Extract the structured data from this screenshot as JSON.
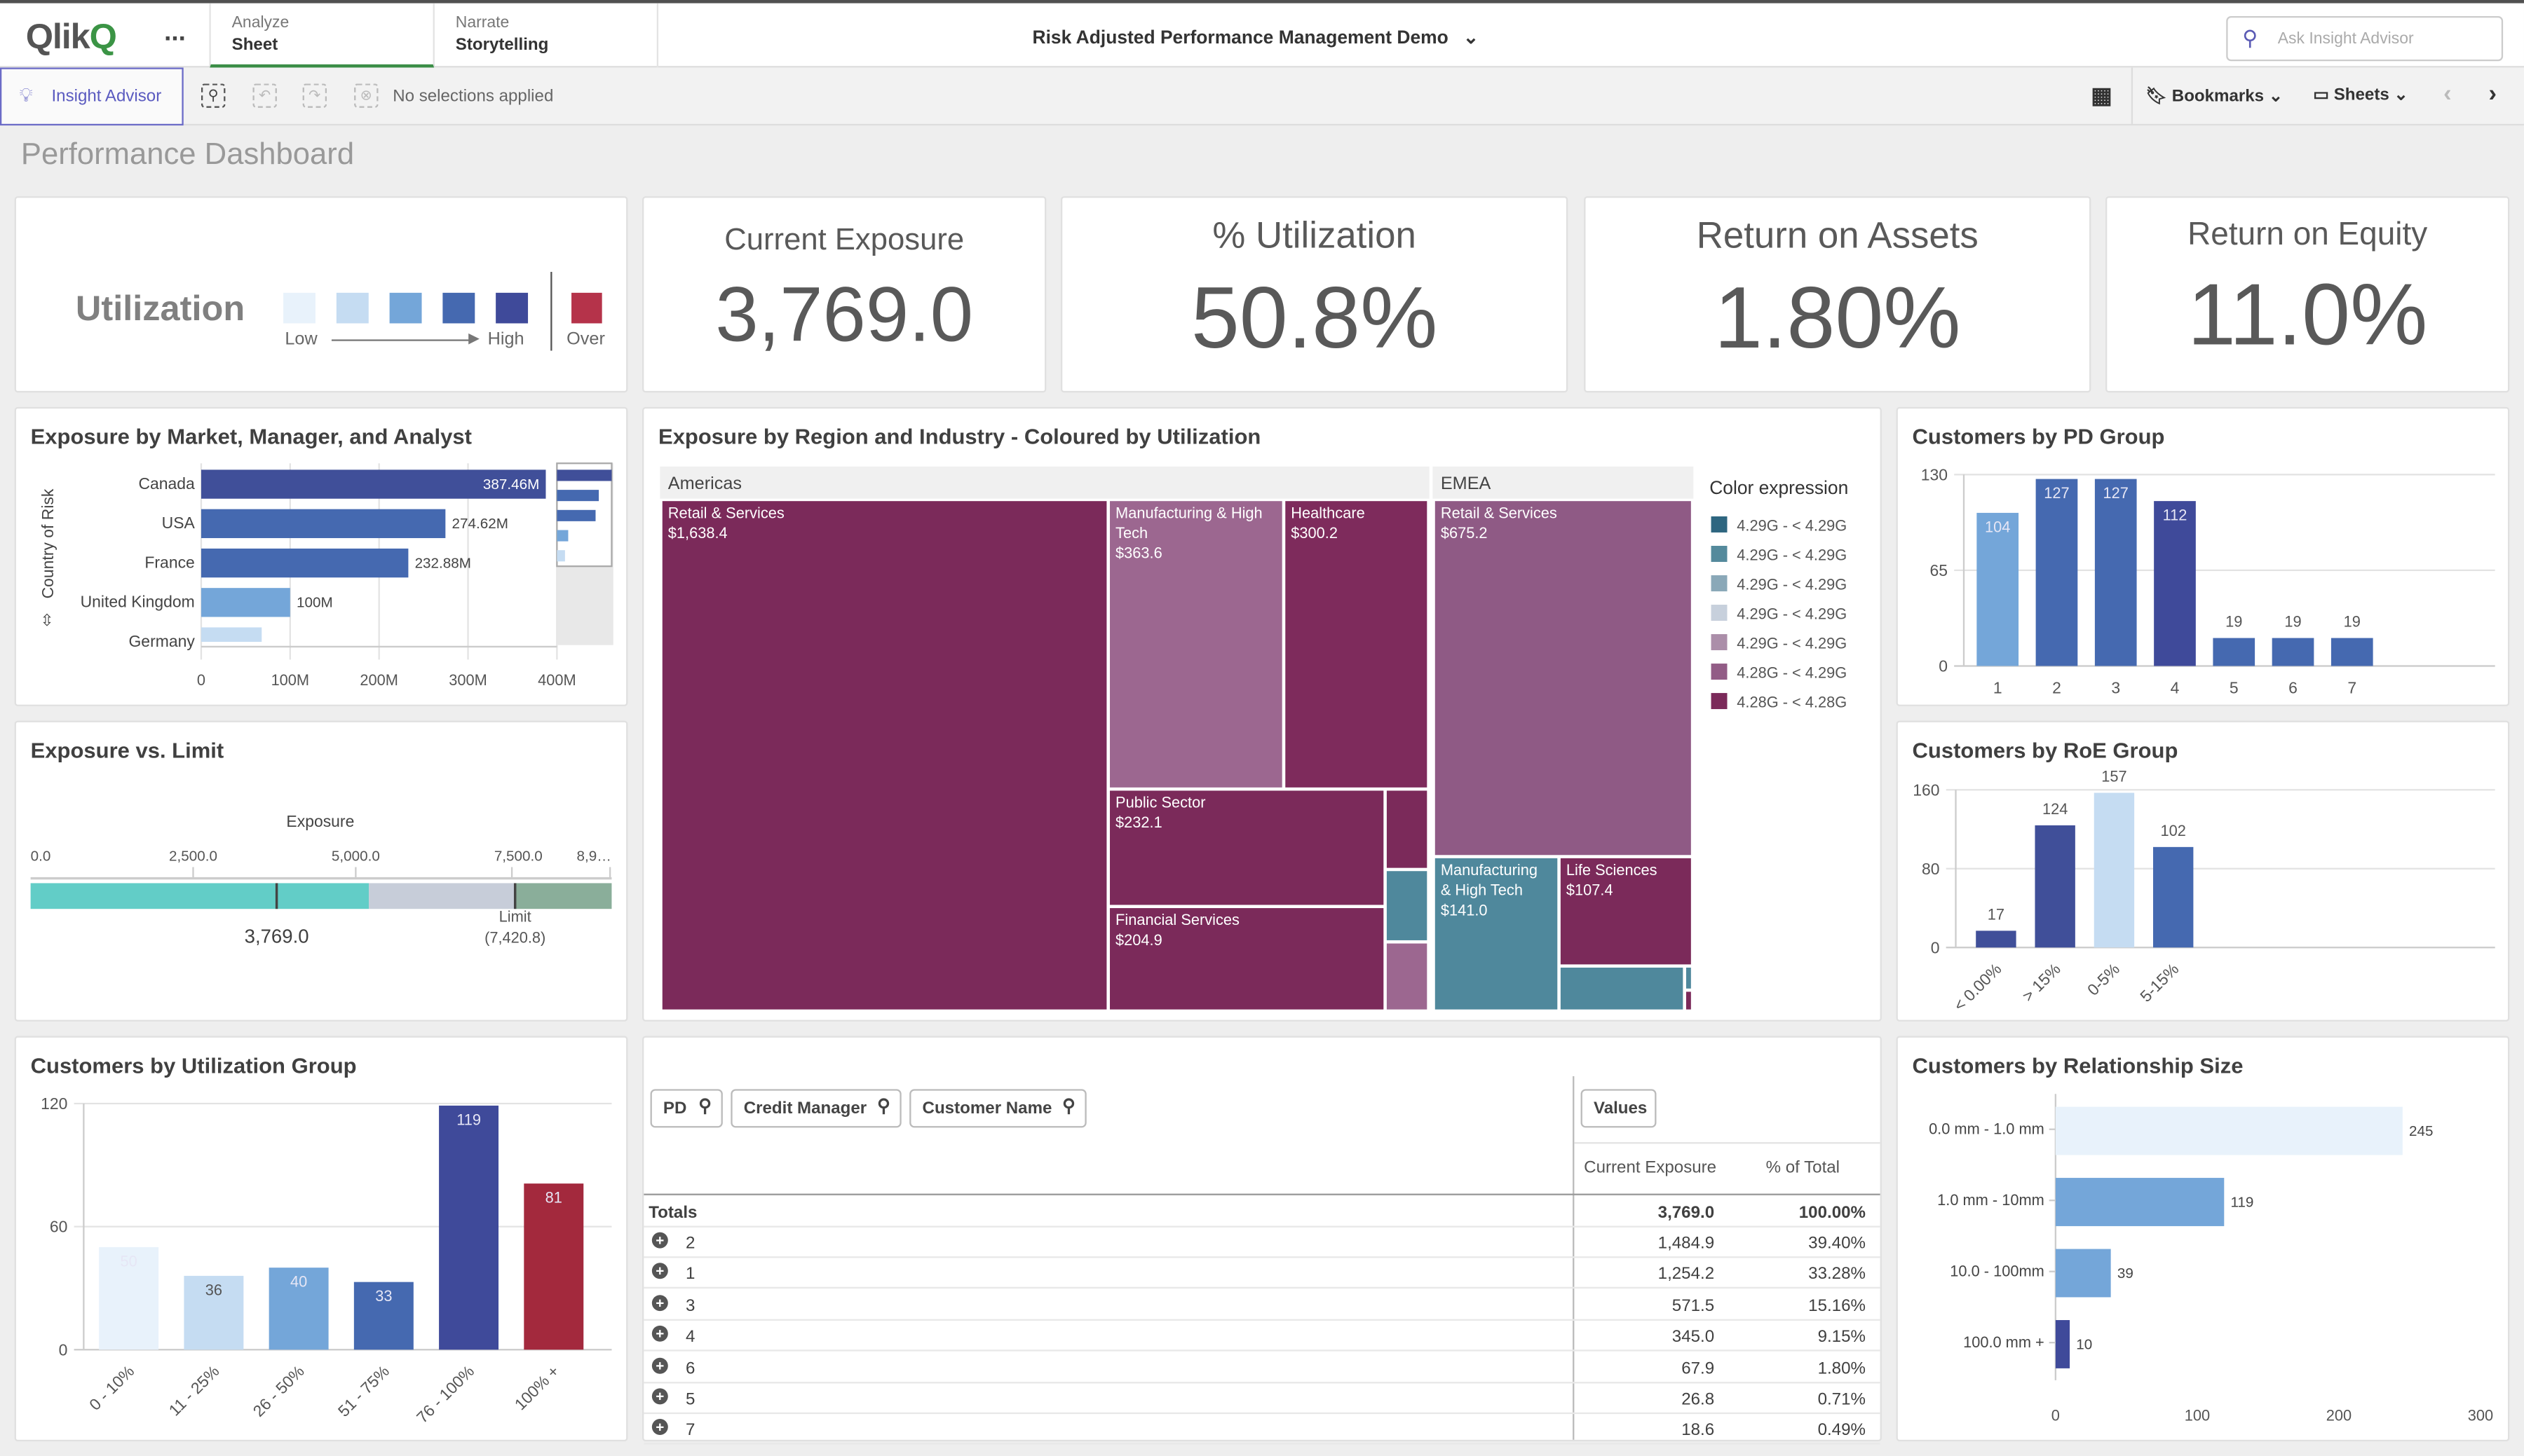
{
  "topbar": {
    "logo": "Qlik",
    "more": "...",
    "tabs": [
      {
        "top": "Analyze",
        "bottom": "Sheet",
        "active": true
      },
      {
        "top": "Narrate",
        "bottom": "Storytelling",
        "active": false
      }
    ],
    "app_title": "Risk Adjusted Performance Management Demo",
    "search_placeholder": "Ask Insight Advisor"
  },
  "toolbar": {
    "insight_advisor": "Insight Advisor",
    "selections": "No selections applied",
    "bookmarks": "Bookmarks",
    "sheets": "Sheets"
  },
  "sheet_title": "Performance Dashboard",
  "utilization_legend": {
    "title": "Utilization",
    "low": "Low",
    "high": "High",
    "over": "Over",
    "scale_colors": [
      "#e8f2fb",
      "#c5dcf2",
      "#74a6d9",
      "#4569b0",
      "#3f4a9a"
    ],
    "over_color": "#b5334a"
  },
  "kpis": [
    {
      "title": "Current Exposure",
      "value": "3,769.0"
    },
    {
      "title": "% Utilization",
      "value": "50.8%"
    },
    {
      "title": "Return on Assets",
      "value": "1.80%"
    },
    {
      "title": "Return on Equity",
      "value": "11.0%"
    }
  ],
  "table": {
    "filters": [
      "PD",
      "Credit Manager",
      "Customer Name"
    ],
    "values_button": "Values",
    "columns": [
      "Current Exposure",
      "% of Total"
    ],
    "totals": {
      "label": "Totals",
      "exposure": "3,769.0",
      "pct": "100.00%"
    },
    "rows": [
      {
        "pd": "2",
        "exposure": "1,484.9",
        "pct": "39.40%"
      },
      {
        "pd": "1",
        "exposure": "1,254.2",
        "pct": "33.28%"
      },
      {
        "pd": "3",
        "exposure": "571.5",
        "pct": "15.16%"
      },
      {
        "pd": "4",
        "exposure": "345.0",
        "pct": "9.15%"
      },
      {
        "pd": "6",
        "exposure": "67.9",
        "pct": "1.80%"
      },
      {
        "pd": "5",
        "exposure": "26.8",
        "pct": "0.71%"
      },
      {
        "pd": "7",
        "exposure": "18.6",
        "pct": "0.49%"
      }
    ]
  },
  "chart_data": [
    {
      "id": "market",
      "type": "bar",
      "orientation": "horizontal",
      "title": "Exposure by Market, Manager, and Analyst",
      "ylabel": "Country of Risk",
      "categories": [
        "Canada",
        "USA",
        "France",
        "United Kingdom",
        "Germany"
      ],
      "values": [
        387.46,
        274.62,
        232.88,
        100,
        68
      ],
      "data_labels": [
        "387.46M",
        "274.62M",
        "232.88M",
        "100M",
        ""
      ],
      "colors": [
        "#404f99",
        "#4569b0",
        "#4569b0",
        "#74a6d9",
        "#c5dcf2"
      ],
      "xticks": [
        "0",
        "100M",
        "200M",
        "300M",
        "400M"
      ],
      "xlim": [
        0,
        400
      ],
      "grid": true
    },
    {
      "id": "treemap",
      "type": "treemap",
      "title": "Exposure by Region and Industry - Coloured by Utilization",
      "groups": [
        {
          "name": "Americas",
          "children": [
            {
              "name": "Retail & Services",
              "value": "$1,638.4",
              "color": "#7b2a5a"
            },
            {
              "name": "Manufacturing & High Tech",
              "value": "$363.6",
              "color": "#9c6790"
            },
            {
              "name": "Healthcare",
              "value": "$300.2",
              "color": "#7e2b5c"
            },
            {
              "name": "Public Sector",
              "value": "$232.1",
              "color": "#7b2a5a"
            },
            {
              "name": "Financial Services",
              "value": "$204.9",
              "color": "#7b2a5a"
            }
          ]
        },
        {
          "name": "EMEA",
          "children": [
            {
              "name": "Retail & Services",
              "value": "$675.2",
              "color": "#8f5a85"
            },
            {
              "name": "Manufacturing & High Tech",
              "value": "$141.0",
              "color": "#4f889c"
            },
            {
              "name": "Life Sciences",
              "value": "$107.4",
              "color": "#7b2a5a"
            }
          ]
        }
      ],
      "legend_title": "Color expression",
      "legend": [
        {
          "label": "4.29G - < 4.29G",
          "color": "#2e6680"
        },
        {
          "label": "4.29G - < 4.29G",
          "color": "#548a9c"
        },
        {
          "label": "4.29G - < 4.29G",
          "color": "#8aa8b8"
        },
        {
          "label": "4.29G - < 4.29G",
          "color": "#c7d0dc"
        },
        {
          "label": "4.29G - < 4.29G",
          "color": "#ab8ea9"
        },
        {
          "label": "4.28G - < 4.29G",
          "color": "#925c86"
        },
        {
          "label": "4.28G - < 4.28G",
          "color": "#7b2a5a"
        }
      ]
    },
    {
      "id": "pd",
      "type": "bar",
      "title": "Customers by PD Group",
      "categories": [
        "1",
        "2",
        "3",
        "4",
        "5",
        "6",
        "7"
      ],
      "values": [
        104,
        127,
        127,
        112,
        19,
        19,
        19
      ],
      "colors": [
        "#74a6d9",
        "#4569b0",
        "#4569b0",
        "#3f4a9a",
        "#4569b0",
        "#4569b0",
        "#4569b0"
      ],
      "yticks": [
        0,
        65,
        130
      ],
      "ylim": [
        0,
        130
      ],
      "grid": true
    },
    {
      "id": "roe",
      "type": "bar",
      "title": "Customers by RoE Group",
      "categories": [
        "< 0.00%",
        "> 15%",
        "0-5%",
        "5-15%"
      ],
      "values": [
        17,
        124,
        157,
        102
      ],
      "colors": [
        "#404f99",
        "#404f99",
        "#c5dcf2",
        "#4569b0"
      ],
      "yticks": [
        0,
        80,
        160
      ],
      "ylim": [
        0,
        160
      ],
      "grid": true
    },
    {
      "id": "util",
      "type": "bar",
      "title": "Customers by Utilization Group",
      "categories": [
        "0 - 10%",
        "11 - 25%",
        "26 - 50%",
        "51 - 75%",
        "76 - 100%",
        "100% +"
      ],
      "values": [
        50,
        36,
        40,
        33,
        119,
        81
      ],
      "colors": [
        "#e8f2fb",
        "#c5dcf2",
        "#74a6d9",
        "#4569b0",
        "#3f4a9a",
        "#a3293d"
      ],
      "yticks": [
        0,
        60,
        120
      ],
      "ylim": [
        0,
        120
      ],
      "grid": true
    },
    {
      "id": "rel",
      "type": "bar",
      "orientation": "horizontal",
      "title": "Customers by Relationship Size",
      "categories": [
        "0.0 mm - 1.0 mm",
        "1.0 mm - 10mm",
        "10.0 - 100mm",
        "100.0 mm +"
      ],
      "values": [
        245,
        119,
        39,
        10
      ],
      "colors": [
        "#e8f2fb",
        "#74a6d9",
        "#74a6d9",
        "#3f4a9a"
      ],
      "xticks": [
        0,
        100,
        200,
        300
      ],
      "xlim": [
        0,
        300
      ],
      "grid": false
    },
    {
      "id": "gauge",
      "type": "bullet",
      "title": "Exposure vs. Limit",
      "measure_label": "Exposure",
      "value": 3769.0,
      "value_label": "3,769.0",
      "limit": 7420.8,
      "limit_label": "Limit",
      "limit_value_label": "(7,420.8)",
      "ticks": [
        "0.0",
        "2,500.0",
        "5,000.0",
        "7,500.0",
        "8,9…"
      ],
      "range": [
        0,
        8900
      ],
      "bands": [
        {
          "to": 5180,
          "color": "#62cdc7"
        },
        {
          "to": 7420.8,
          "color": "#c7cdd9"
        },
        {
          "to": 8900,
          "color": "#8aae9a"
        }
      ]
    }
  ]
}
